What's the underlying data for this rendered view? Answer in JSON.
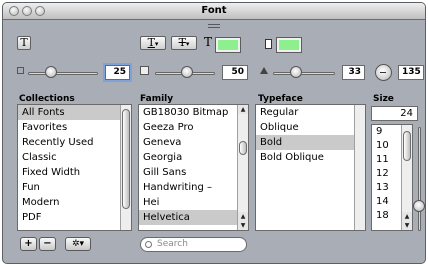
{
  "window": {
    "title": "Font"
  },
  "toolbar": {
    "text_style_glyph": "T",
    "underline_glyph": "T",
    "strikethrough_glyph": "T",
    "dropdown_glyph": "▾",
    "text_color_glyph": "T",
    "text_color": "#8eef8e",
    "doc_color": "#8eef8e"
  },
  "sliders": {
    "shadow_opacity": "25",
    "shadow_blur": "50",
    "shadow_offset": "33",
    "shadow_angle": "135"
  },
  "collections": {
    "header": "Collections",
    "items": [
      "All Fonts",
      "Favorites",
      "Recently Used",
      "Classic",
      "Fixed Width",
      "Fun",
      "Modern",
      "PDF"
    ],
    "selected": "All Fonts"
  },
  "family": {
    "header": "Family",
    "items": [
      "GB18030 Bitmap",
      "Geeza Pro",
      "Geneva",
      "Georgia",
      "Gill Sans",
      "Handwriting –",
      "Hei",
      "Helvetica"
    ],
    "selected": "Helvetica"
  },
  "typeface": {
    "header": "Typeface",
    "items": [
      "Regular",
      "Oblique",
      "Bold",
      "Bold Oblique"
    ],
    "selected": "Bold"
  },
  "size": {
    "header": "Size",
    "value": "24",
    "items": [
      "9",
      "10",
      "11",
      "12",
      "13",
      "14",
      "18"
    ]
  },
  "bottom": {
    "add_label": "+",
    "remove_label": "−",
    "action_label": "✲▾",
    "search_placeholder": "Search"
  }
}
